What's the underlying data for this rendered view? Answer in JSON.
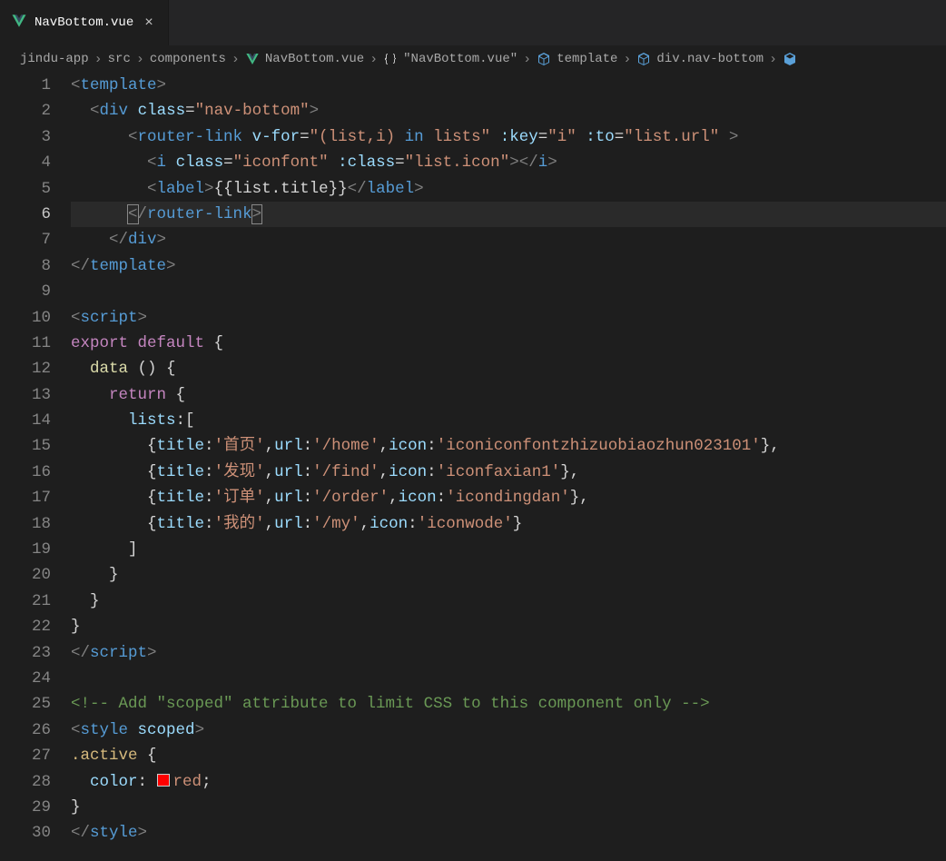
{
  "tab": {
    "filename": "NavBottom.vue"
  },
  "breadcrumbs": {
    "parts": [
      "jindu-app",
      "src",
      "components",
      "NavBottom.vue",
      "\"NavBottom.vue\"",
      "template",
      "div.nav-bottom"
    ]
  },
  "editor": {
    "active_line": 6,
    "lines": [
      {
        "n": 1,
        "tokens": [
          {
            "t": "<",
            "c": "s-punc"
          },
          {
            "t": "template",
            "c": "s-tag"
          },
          {
            "t": ">",
            "c": "s-punc"
          }
        ],
        "indent": 0
      },
      {
        "n": 2,
        "tokens": [
          {
            "t": "<",
            "c": "s-punc"
          },
          {
            "t": "div",
            "c": "s-tag"
          },
          {
            "t": " ",
            "c": ""
          },
          {
            "t": "class",
            "c": "s-attr"
          },
          {
            "t": "=",
            "c": "s-white"
          },
          {
            "t": "\"nav-bottom\"",
            "c": "s-str"
          },
          {
            "t": ">",
            "c": "s-punc"
          }
        ],
        "indent": 1
      },
      {
        "n": 3,
        "tokens": [
          {
            "t": "<",
            "c": "s-punc"
          },
          {
            "t": "router-link",
            "c": "s-tag"
          },
          {
            "t": " ",
            "c": ""
          },
          {
            "t": "v-for",
            "c": "s-attr"
          },
          {
            "t": "=",
            "c": "s-white"
          },
          {
            "t": "\"(list,i) ",
            "c": "s-str"
          },
          {
            "t": "in",
            "c": "s-keyword2"
          },
          {
            "t": " lists\"",
            "c": "s-str"
          },
          {
            "t": " ",
            "c": ""
          },
          {
            "t": ":key",
            "c": "s-attr"
          },
          {
            "t": "=",
            "c": "s-white"
          },
          {
            "t": "\"i\"",
            "c": "s-str"
          },
          {
            "t": " ",
            "c": ""
          },
          {
            "t": ":to",
            "c": "s-attr"
          },
          {
            "t": "=",
            "c": "s-white"
          },
          {
            "t": "\"list.url\"",
            "c": "s-str"
          },
          {
            "t": " ",
            "c": ""
          },
          {
            "t": ">",
            "c": "s-punc"
          }
        ],
        "indent": 3
      },
      {
        "n": 4,
        "tokens": [
          {
            "t": "<",
            "c": "s-punc"
          },
          {
            "t": "i",
            "c": "s-tag"
          },
          {
            "t": " ",
            "c": ""
          },
          {
            "t": "class",
            "c": "s-attr"
          },
          {
            "t": "=",
            "c": "s-white"
          },
          {
            "t": "\"iconfont\"",
            "c": "s-str"
          },
          {
            "t": " ",
            "c": ""
          },
          {
            "t": ":class",
            "c": "s-attr"
          },
          {
            "t": "=",
            "c": "s-white"
          },
          {
            "t": "\"list.icon\"",
            "c": "s-str"
          },
          {
            "t": "></",
            "c": "s-punc"
          },
          {
            "t": "i",
            "c": "s-tag"
          },
          {
            "t": ">",
            "c": "s-punc"
          }
        ],
        "indent": 4
      },
      {
        "n": 5,
        "tokens": [
          {
            "t": "<",
            "c": "s-punc"
          },
          {
            "t": "label",
            "c": "s-tag"
          },
          {
            "t": ">",
            "c": "s-punc"
          },
          {
            "t": "{{",
            "c": "s-white"
          },
          {
            "t": "list.title",
            "c": "s-text"
          },
          {
            "t": "}}",
            "c": "s-white"
          },
          {
            "t": "</",
            "c": "s-punc"
          },
          {
            "t": "label",
            "c": "s-tag"
          },
          {
            "t": ">",
            "c": "s-punc"
          }
        ],
        "indent": 4
      },
      {
        "n": 6,
        "tokens": [
          {
            "t": "<",
            "c": "s-punc bracket-hl"
          },
          {
            "t": "/",
            "c": "s-punc"
          },
          {
            "t": "router-link",
            "c": "s-tag"
          },
          {
            "t": ">",
            "c": "s-punc bracket-hl"
          }
        ],
        "indent": 3,
        "current": true
      },
      {
        "n": 7,
        "tokens": [
          {
            "t": "</",
            "c": "s-punc"
          },
          {
            "t": "div",
            "c": "s-tag"
          },
          {
            "t": ">",
            "c": "s-punc"
          }
        ],
        "indent": 2
      },
      {
        "n": 8,
        "tokens": [
          {
            "t": "</",
            "c": "s-punc"
          },
          {
            "t": "template",
            "c": "s-tag"
          },
          {
            "t": ">",
            "c": "s-punc"
          }
        ],
        "indent": 0
      },
      {
        "n": 9,
        "tokens": [],
        "indent": 0
      },
      {
        "n": 10,
        "tokens": [
          {
            "t": "<",
            "c": "s-punc"
          },
          {
            "t": "script",
            "c": "s-tag"
          },
          {
            "t": ">",
            "c": "s-punc"
          }
        ],
        "indent": 0
      },
      {
        "n": 11,
        "tokens": [
          {
            "t": "export",
            "c": "s-keyword"
          },
          {
            "t": " ",
            "c": ""
          },
          {
            "t": "default",
            "c": "s-keyword"
          },
          {
            "t": " {",
            "c": "s-white"
          }
        ],
        "indent": 0
      },
      {
        "n": 12,
        "tokens": [
          {
            "t": "data",
            "c": "s-func"
          },
          {
            "t": " () {",
            "c": "s-white"
          }
        ],
        "indent": 1
      },
      {
        "n": 13,
        "tokens": [
          {
            "t": "return",
            "c": "s-keyword"
          },
          {
            "t": " {",
            "c": "s-white"
          }
        ],
        "indent": 2
      },
      {
        "n": 14,
        "tokens": [
          {
            "t": "lists",
            "c": "s-var"
          },
          {
            "t": ":",
            "c": "s-white"
          },
          {
            "t": "[",
            "c": "s-white"
          }
        ],
        "indent": 3
      },
      {
        "n": 15,
        "tokens": [
          {
            "t": "{",
            "c": "s-white"
          },
          {
            "t": "title",
            "c": "s-prop"
          },
          {
            "t": ":",
            "c": "s-white"
          },
          {
            "t": "'首页'",
            "c": "s-str"
          },
          {
            "t": ",",
            "c": "s-white"
          },
          {
            "t": "url",
            "c": "s-prop"
          },
          {
            "t": ":",
            "c": "s-white"
          },
          {
            "t": "'/home'",
            "c": "s-str"
          },
          {
            "t": ",",
            "c": "s-white"
          },
          {
            "t": "icon",
            "c": "s-prop"
          },
          {
            "t": ":",
            "c": "s-white"
          },
          {
            "t": "'iconiconfontzhizuobiaozhun023101'",
            "c": "s-str"
          },
          {
            "t": "},",
            "c": "s-white"
          }
        ],
        "indent": 4
      },
      {
        "n": 16,
        "tokens": [
          {
            "t": "{",
            "c": "s-white"
          },
          {
            "t": "title",
            "c": "s-prop"
          },
          {
            "t": ":",
            "c": "s-white"
          },
          {
            "t": "'发现'",
            "c": "s-str"
          },
          {
            "t": ",",
            "c": "s-white"
          },
          {
            "t": "url",
            "c": "s-prop"
          },
          {
            "t": ":",
            "c": "s-white"
          },
          {
            "t": "'/find'",
            "c": "s-str"
          },
          {
            "t": ",",
            "c": "s-white"
          },
          {
            "t": "icon",
            "c": "s-prop"
          },
          {
            "t": ":",
            "c": "s-white"
          },
          {
            "t": "'iconfaxian1'",
            "c": "s-str"
          },
          {
            "t": "},",
            "c": "s-white"
          }
        ],
        "indent": 4
      },
      {
        "n": 17,
        "tokens": [
          {
            "t": "{",
            "c": "s-white"
          },
          {
            "t": "title",
            "c": "s-prop"
          },
          {
            "t": ":",
            "c": "s-white"
          },
          {
            "t": "'订单'",
            "c": "s-str"
          },
          {
            "t": ",",
            "c": "s-white"
          },
          {
            "t": "url",
            "c": "s-prop"
          },
          {
            "t": ":",
            "c": "s-white"
          },
          {
            "t": "'/order'",
            "c": "s-str"
          },
          {
            "t": ",",
            "c": "s-white"
          },
          {
            "t": "icon",
            "c": "s-prop"
          },
          {
            "t": ":",
            "c": "s-white"
          },
          {
            "t": "'icondingdan'",
            "c": "s-str"
          },
          {
            "t": "},",
            "c": "s-white"
          }
        ],
        "indent": 4
      },
      {
        "n": 18,
        "tokens": [
          {
            "t": "{",
            "c": "s-white"
          },
          {
            "t": "title",
            "c": "s-prop"
          },
          {
            "t": ":",
            "c": "s-white"
          },
          {
            "t": "'我的'",
            "c": "s-str"
          },
          {
            "t": ",",
            "c": "s-white"
          },
          {
            "t": "url",
            "c": "s-prop"
          },
          {
            "t": ":",
            "c": "s-white"
          },
          {
            "t": "'/my'",
            "c": "s-str"
          },
          {
            "t": ",",
            "c": "s-white"
          },
          {
            "t": "icon",
            "c": "s-prop"
          },
          {
            "t": ":",
            "c": "s-white"
          },
          {
            "t": "'iconwode'",
            "c": "s-str"
          },
          {
            "t": "}",
            "c": "s-white"
          }
        ],
        "indent": 4
      },
      {
        "n": 19,
        "tokens": [
          {
            "t": "]",
            "c": "s-white"
          }
        ],
        "indent": 3
      },
      {
        "n": 20,
        "tokens": [
          {
            "t": "}",
            "c": "s-white"
          }
        ],
        "indent": 2
      },
      {
        "n": 21,
        "tokens": [
          {
            "t": "}",
            "c": "s-white"
          }
        ],
        "indent": 1
      },
      {
        "n": 22,
        "tokens": [
          {
            "t": "}",
            "c": "s-white"
          }
        ],
        "indent": 0
      },
      {
        "n": 23,
        "tokens": [
          {
            "t": "</",
            "c": "s-punc"
          },
          {
            "t": "script",
            "c": "s-tag"
          },
          {
            "t": ">",
            "c": "s-punc"
          }
        ],
        "indent": 0
      },
      {
        "n": 24,
        "tokens": [],
        "indent": 0
      },
      {
        "n": 25,
        "tokens": [
          {
            "t": "<!-- Add \"scoped\" attribute to limit CSS to this component only -->",
            "c": "s-comment"
          }
        ],
        "indent": 0
      },
      {
        "n": 26,
        "tokens": [
          {
            "t": "<",
            "c": "s-punc"
          },
          {
            "t": "style",
            "c": "s-tag"
          },
          {
            "t": " ",
            "c": ""
          },
          {
            "t": "scoped",
            "c": "s-attr"
          },
          {
            "t": ">",
            "c": "s-punc"
          }
        ],
        "indent": 0
      },
      {
        "n": 27,
        "tokens": [
          {
            "t": ".active",
            "c": "s-sel"
          },
          {
            "t": " {",
            "c": "s-white"
          }
        ],
        "indent": 0
      },
      {
        "n": 28,
        "tokens": [
          {
            "t": "color",
            "c": "s-prop"
          },
          {
            "t": ": ",
            "c": "s-white"
          },
          {
            "t": "SWATCH",
            "c": "swatch"
          },
          {
            "t": "red",
            "c": "s-val"
          },
          {
            "t": ";",
            "c": "s-white"
          }
        ],
        "indent": 1
      },
      {
        "n": 29,
        "tokens": [
          {
            "t": "}",
            "c": "s-white"
          }
        ],
        "indent": 0
      },
      {
        "n": 30,
        "tokens": [
          {
            "t": "</",
            "c": "s-punc"
          },
          {
            "t": "style",
            "c": "s-tag"
          },
          {
            "t": ">",
            "c": "s-punc"
          }
        ],
        "indent": 0
      }
    ]
  }
}
